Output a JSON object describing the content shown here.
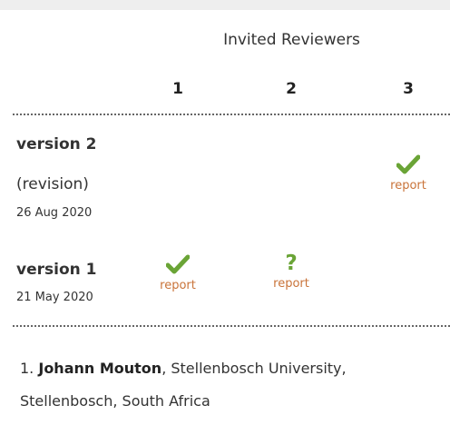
{
  "header": {
    "title": "Invited Reviewers",
    "columns": [
      "1",
      "2",
      "3"
    ]
  },
  "versions": [
    {
      "label": "version 2",
      "note": "(revision)",
      "date": "26 Aug 2020",
      "reviews": [
        {
          "reviewer": "3",
          "status": "approved",
          "icon": "check-icon",
          "link": "report"
        }
      ]
    },
    {
      "label": "version 1",
      "note": "",
      "date": "21 May 2020",
      "reviews": [
        {
          "reviewer": "1",
          "status": "approved",
          "icon": "check-icon",
          "link": "report"
        },
        {
          "reviewer": "2",
          "status": "approved-with-reservations",
          "icon": "question-icon",
          "link": "report"
        }
      ]
    }
  ],
  "reviewers": [
    {
      "number": "1.",
      "name": "Johann Mouton",
      "affiliation": ", Stellenbosch University, Stellenbosch, South Africa"
    }
  ],
  "colors": {
    "approved": "#6aa436",
    "link": "#c97339",
    "background": "#eeeeee"
  }
}
